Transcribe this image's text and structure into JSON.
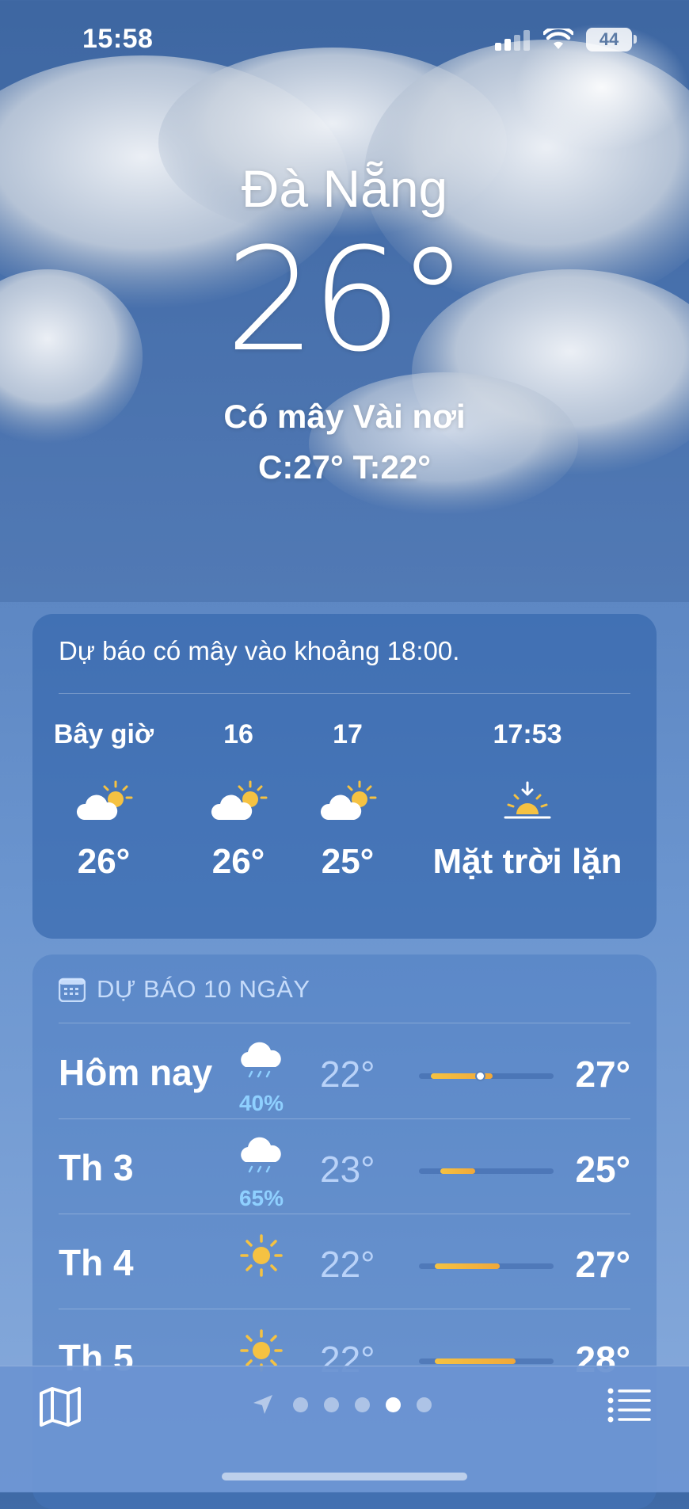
{
  "status_bar": {
    "time": "15:58",
    "battery": "44"
  },
  "header": {
    "city": "Đà Nẵng",
    "temperature": "26°",
    "condition": "Có mây Vài nơi",
    "high_low": "C:27°  T:22°"
  },
  "hourly": {
    "summary": "Dự báo có mây vào khoảng 18:00.",
    "items": [
      {
        "label": "Bây giờ",
        "icon": "partly-cloudy-icon",
        "value": "26°"
      },
      {
        "label": "16",
        "icon": "partly-cloudy-icon",
        "value": "26°"
      },
      {
        "label": "17",
        "icon": "partly-cloudy-icon",
        "value": "25°"
      },
      {
        "label": "17:53",
        "icon": "sunset-icon",
        "value": "Mặt trời lặn"
      }
    ]
  },
  "ten_day": {
    "title": "DỰ BÁO 10 NGÀY",
    "days": [
      {
        "name": "Hôm nay",
        "icon": "rain-cloud-icon",
        "precip": "40%",
        "low": "22°",
        "high": "27°",
        "range": [
          0.09,
          0.55
        ],
        "current": 0.45
      },
      {
        "name": "Th 3",
        "icon": "rain-cloud-icon",
        "precip": "65%",
        "low": "23°",
        "high": "25°",
        "range": [
          0.16,
          0.42
        ]
      },
      {
        "name": "Th 4",
        "icon": "sun-icon",
        "precip": "",
        "low": "22°",
        "high": "27°",
        "range": [
          0.12,
          0.6
        ]
      },
      {
        "name": "Th 5",
        "icon": "sun-icon",
        "precip": "",
        "low": "22°",
        "high": "28°",
        "range": [
          0.12,
          0.72
        ]
      }
    ]
  },
  "colors": {
    "accent_sun": "#f5c242",
    "precip": "#8fd0ff"
  }
}
